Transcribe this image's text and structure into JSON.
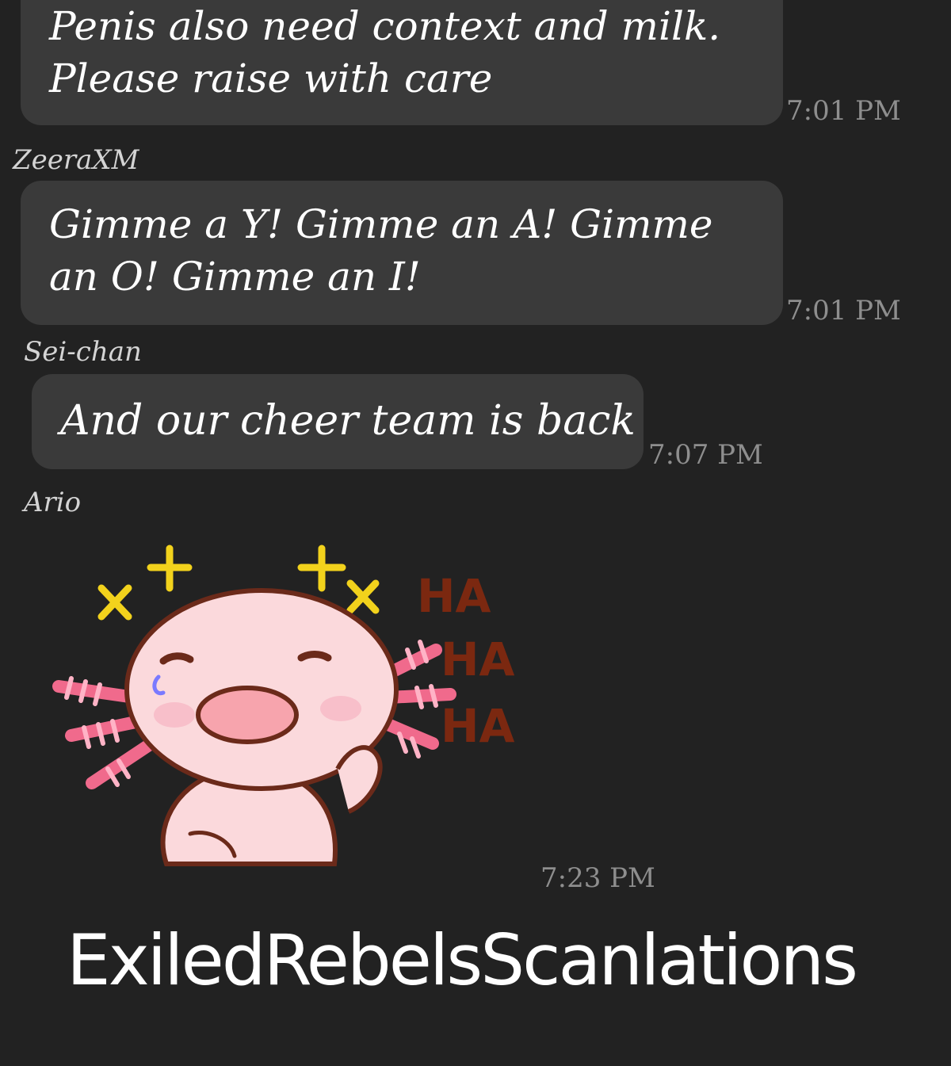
{
  "messages": [
    {
      "sender": "",
      "text": "Penis also need context and milk.\nPlease raise with care",
      "time": "7:01 PM"
    },
    {
      "sender": "ZeeraXM",
      "text": "Gimme a Y! Gimme an A! Gimme\nan O! Gimme an I!",
      "time": "7:01 PM"
    },
    {
      "sender": "Sei-chan",
      "text": "And our cheer team is back",
      "time": "7:07 PM"
    },
    {
      "sender": "Ario",
      "sticker": "laughing-axolotl-sticker",
      "sticker_text": [
        "HA",
        "HA",
        "HA"
      ],
      "time": "7:23 PM"
    }
  ],
  "watermark": "ExiledRebelsScanlations",
  "colors": {
    "background": "#222222",
    "bubble": "#3a3a3a",
    "message_text": "#ffffff",
    "sender": "#d4d4d4",
    "timestamp": "#8e8e8e",
    "axolotl_body": "#fbd9dc",
    "axolotl_gills": "#f06a8c",
    "sparkles": "#f2d21c",
    "ha_text": "#8b2a0e"
  }
}
